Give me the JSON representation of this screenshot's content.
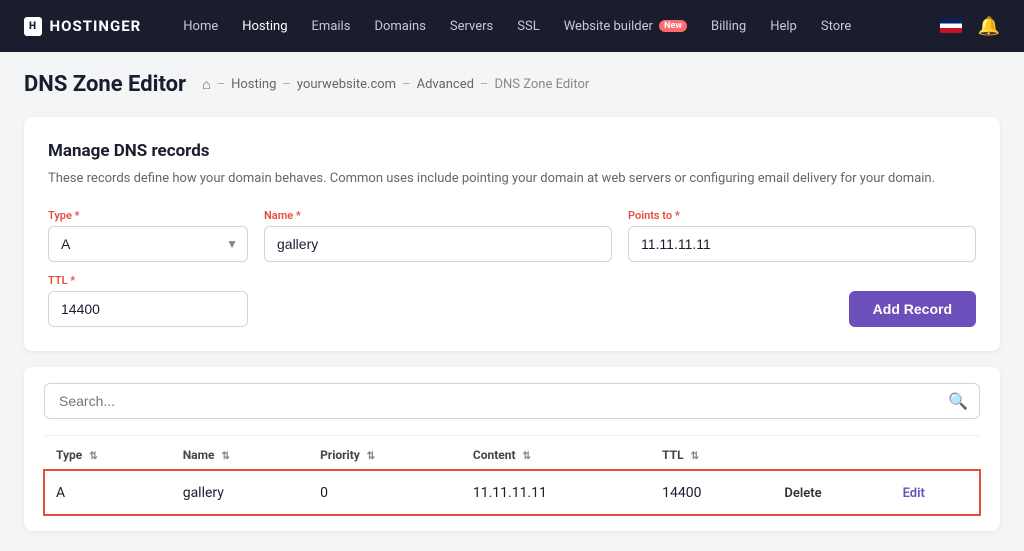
{
  "brand": {
    "logo_box": "H",
    "logo_text": "HOSTINGER"
  },
  "nav": {
    "links": [
      {
        "label": "Home",
        "active": false
      },
      {
        "label": "Hosting",
        "active": true
      },
      {
        "label": "Emails",
        "active": false
      },
      {
        "label": "Domains",
        "active": false
      },
      {
        "label": "Servers",
        "active": false
      },
      {
        "label": "SSL",
        "active": false
      },
      {
        "label": "Website builder",
        "active": false,
        "badge": "New"
      },
      {
        "label": "Billing",
        "active": false
      },
      {
        "label": "Help",
        "active": false
      },
      {
        "label": "Store",
        "active": false
      }
    ]
  },
  "breadcrumb": {
    "home_icon": "⌂",
    "sep": "–",
    "items": [
      "Hosting",
      "yourwebsite.com",
      "Advanced",
      "DNS Zone Editor"
    ]
  },
  "page": {
    "title": "DNS Zone Editor"
  },
  "form": {
    "section_title": "Manage DNS records",
    "section_desc": "These records define how your domain behaves. Common uses include pointing your domain at web servers or configuring email delivery for your domain.",
    "type_label": "Type",
    "type_value": "A",
    "name_label": "Name",
    "name_value": "gallery",
    "points_label": "Points to",
    "points_value": "11.11.11.11",
    "ttl_label": "TTL",
    "ttl_value": "14400",
    "add_btn": "Add Record"
  },
  "search": {
    "placeholder": "Search..."
  },
  "table": {
    "columns": [
      {
        "label": "Type",
        "sortable": true
      },
      {
        "label": "Name",
        "sortable": true
      },
      {
        "label": "Priority",
        "sortable": true
      },
      {
        "label": "Content",
        "sortable": true
      },
      {
        "label": "TTL",
        "sortable": true
      }
    ],
    "rows": [
      {
        "type": "A",
        "name": "gallery",
        "priority": "0",
        "content": "11.11.11.11",
        "ttl": "14400",
        "highlighted": true,
        "delete_label": "Delete",
        "edit_label": "Edit"
      }
    ]
  }
}
